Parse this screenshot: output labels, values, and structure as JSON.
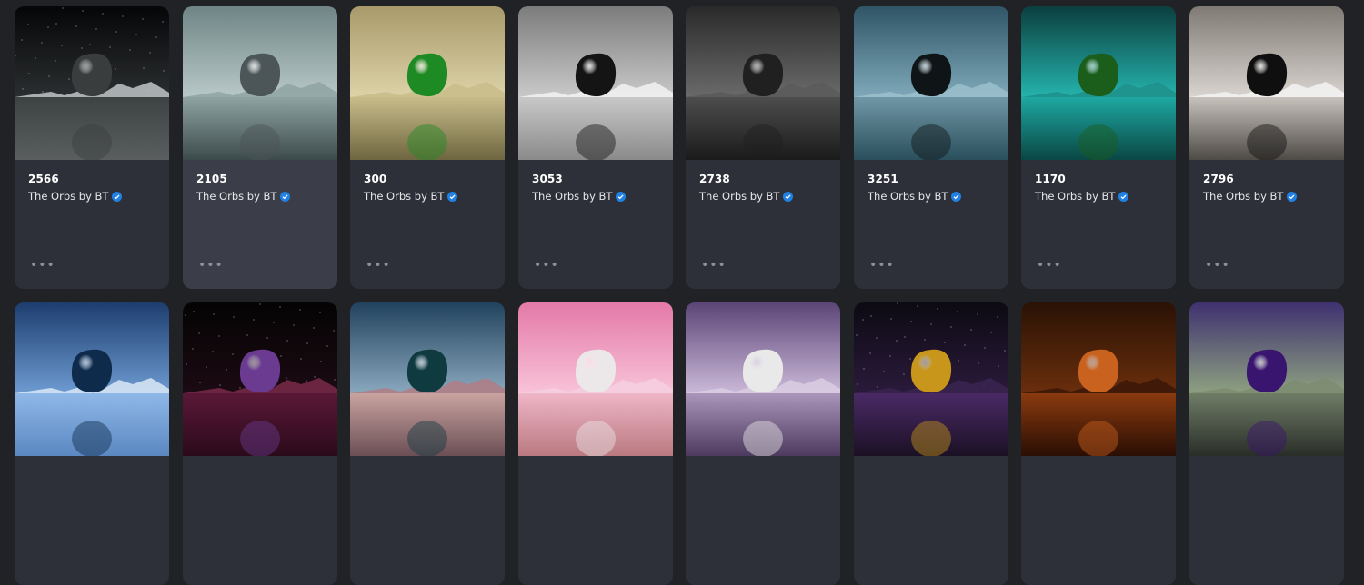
{
  "cards": [
    {
      "token": "2566",
      "collection": "The Orbs by BT",
      "sky_top": "#050607",
      "sky_bottom": "#2b2e30",
      "sea_top": "#3d4242",
      "sea_bottom": "#5a5e5e",
      "orb": "#3a3d3d",
      "mount": "#bfc4c5",
      "stars": true
    },
    {
      "token": "2105",
      "collection": "The Orbs by BT",
      "sky_top": "#6f8585",
      "sky_bottom": "#b9c8c8",
      "sea_top": "#8fa3a3",
      "sea_bottom": "#3c4a4a",
      "orb": "#4c5558",
      "mount": "#8fa3a3",
      "stars": false
    },
    {
      "token": "300",
      "collection": "The Orbs by BT",
      "sky_top": "#a89a6a",
      "sky_bottom": "#ddd3a8",
      "sea_top": "#c8bc8a",
      "sea_bottom": "#6e6640",
      "orb": "#1e8a24",
      "mount": "#c8bc8a",
      "stars": false
    },
    {
      "token": "3053",
      "collection": "The Orbs by BT",
      "sky_top": "#7c7c7c",
      "sky_bottom": "#c9c9c9",
      "sea_top": "#c8c8c8",
      "sea_bottom": "#8a8a8a",
      "orb": "#141414",
      "mount": "#f2f2f2",
      "stars": false
    },
    {
      "token": "2738",
      "collection": "The Orbs by BT",
      "sky_top": "#2a2a2a",
      "sky_bottom": "#6a6a6a",
      "sea_top": "#4d4d4d",
      "sea_bottom": "#1a1a1a",
      "orb": "#202020",
      "mount": "#5a5a5a",
      "stars": false
    },
    {
      "token": "3251",
      "collection": "The Orbs by BT",
      "sky_top": "#2f5566",
      "sky_bottom": "#7fa9ba",
      "sea_top": "#6f97a6",
      "sea_bottom": "#2b4f5c",
      "orb": "#0f1416",
      "mount": "#9cc0cc",
      "stars": false
    },
    {
      "token": "1170",
      "collection": "The Orbs by BT",
      "sky_top": "#0b3f3e",
      "sky_bottom": "#25b3ad",
      "sea_top": "#1ea8a2",
      "sea_bottom": "#0a4744",
      "orb": "#1b5e1c",
      "mount": "#1e8f8a",
      "stars": false
    },
    {
      "token": "2796",
      "collection": "The Orbs by BT",
      "sky_top": "#807a74",
      "sky_bottom": "#d9d4cf",
      "sea_top": "#c6c1bb",
      "sea_bottom": "#4e4a46",
      "orb": "#0f0f0f",
      "mount": "#f3f3f3",
      "stars": false
    },
    {
      "token": "",
      "collection": "",
      "sky_top": "#1d3d6e",
      "sky_bottom": "#6d9bd1",
      "sea_top": "#8fb8e8",
      "sea_bottom": "#5b88c2",
      "orb": "#0e2b4c",
      "mount": "#dbe8f6",
      "stars": false
    },
    {
      "token": "",
      "collection": "",
      "sky_top": "#040404",
      "sky_bottom": "#1b0a12",
      "sea_top": "#5a1838",
      "sea_bottom": "#2a0a1a",
      "orb": "#6a3b91",
      "mount": "#7a2a4a",
      "stars": true
    },
    {
      "token": "",
      "collection": "",
      "sky_top": "#21425e",
      "sky_bottom": "#8aa8bd",
      "sea_top": "#c9a3a0",
      "sea_bottom": "#6b4f55",
      "orb": "#0f3a40",
      "mount": "#b07d85",
      "stars": false
    },
    {
      "token": "",
      "collection": "",
      "sky_top": "#e479a8",
      "sky_bottom": "#f8c3d8",
      "sea_top": "#efb6c8",
      "sea_bottom": "#b9797f",
      "orb": "#ece7e8",
      "mount": "#f6cfe0",
      "stars": false
    },
    {
      "token": "",
      "collection": "",
      "sky_top": "#5b4577",
      "sky_bottom": "#cbb9d8",
      "sea_top": "#ab96bb",
      "sea_bottom": "#4e3a5e",
      "orb": "#e9e9e9",
      "mount": "#d9cde2",
      "stars": false
    },
    {
      "token": "",
      "collection": "",
      "sky_top": "#0c0a12",
      "sky_bottom": "#2a1a3b",
      "sea_top": "#4a2a66",
      "sea_bottom": "#1b1024",
      "orb": "#c7961a",
      "mount": "#3a2450",
      "stars": true
    },
    {
      "token": "",
      "collection": "",
      "sky_top": "#2a1205",
      "sky_bottom": "#6a2e0c",
      "sea_top": "#8a3a0e",
      "sea_bottom": "#2a0e04",
      "orb": "#c9611f",
      "mount": "#3a1608",
      "stars": false
    },
    {
      "token": "",
      "collection": "",
      "sky_top": "#3f3170",
      "sky_bottom": "#8da080",
      "sea_top": "#6f7d66",
      "sea_bottom": "#2a2d28",
      "orb": "#3a1570",
      "mount": "#7d8c70",
      "stars": false
    }
  ],
  "more_label": "•••"
}
